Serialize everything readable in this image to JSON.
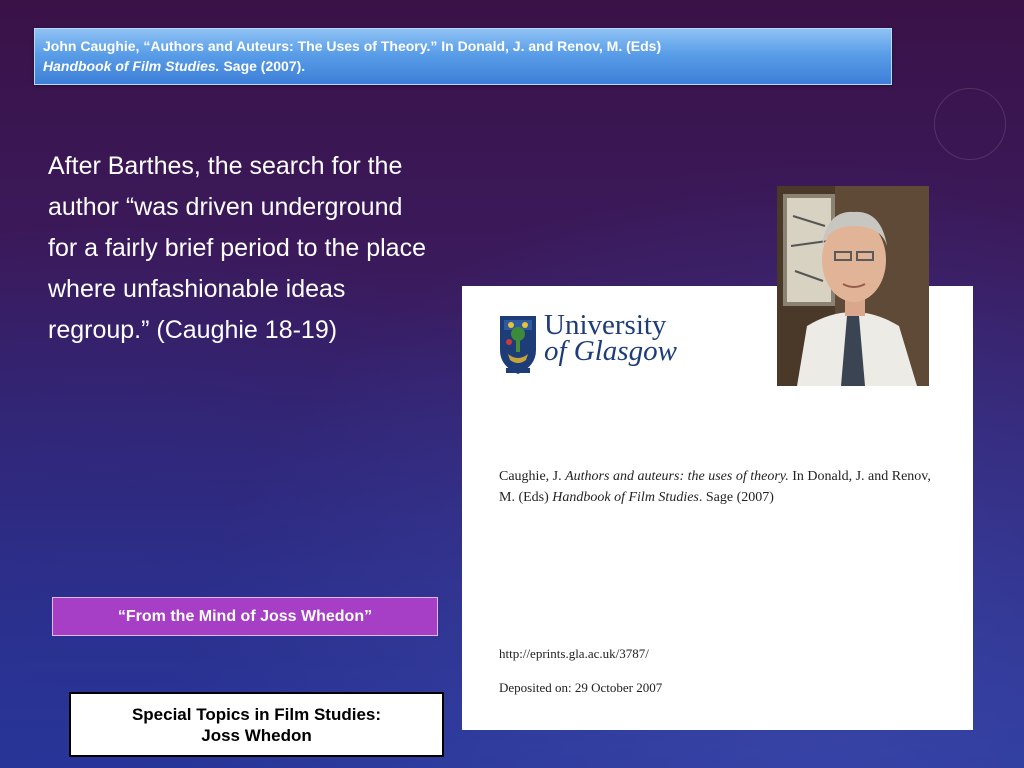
{
  "citation_header": {
    "line1": "John Caughie, “Authors and Auteurs: The Uses of Theory.” In Donald, J. and Renov, M. (Eds)",
    "line2_title": "Handbook of Film Studies.",
    "line2_rest": " Sage (2007)."
  },
  "body_quote": "After Barthes, the search for the author “was driven underground for a fairly brief period to the place where unfashionable ideas regroup.” (Caughie 18-19)",
  "document_image": {
    "logo_line1": "University",
    "logo_line2": "of Glasgow",
    "cite_author": "Caughie, J. ",
    "cite_title": "Authors and auteurs: the uses of theory.",
    "cite_middle": " In Donald, J. and Renov, M. (Eds) ",
    "cite_book": "Handbook of Film Studies",
    "cite_end": ". Sage (2007)",
    "url": "http://eprints.gla.ac.uk/3787/",
    "deposited": "Deposited on: 29 October 2007"
  },
  "photo": {
    "icon": "author-portrait"
  },
  "source_tag": "“From the Mind of Joss Whedon”",
  "course_footer": {
    "line1": "Special Topics in Film Studies:",
    "line2": "Joss Whedon"
  }
}
